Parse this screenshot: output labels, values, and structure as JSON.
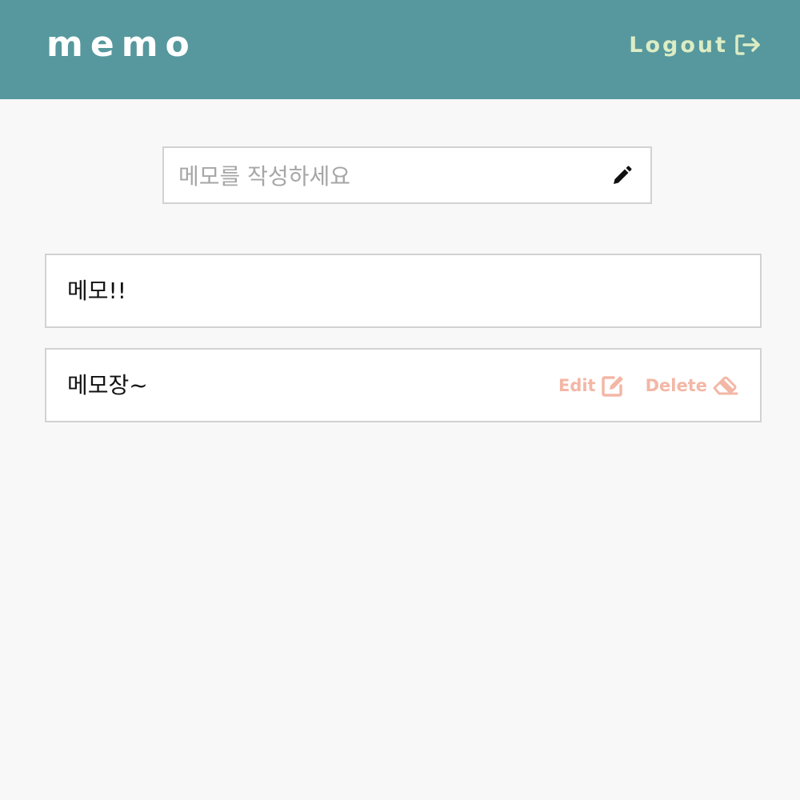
{
  "header": {
    "logo": "memo",
    "logout_label": "Logout",
    "bg_color": "#56989d"
  },
  "compose": {
    "placeholder": "메모를 작성하세요",
    "value": "",
    "icon": "pencil-icon"
  },
  "memos": [
    {
      "text": "메모!!",
      "actions_visible": false
    },
    {
      "text": "메모장~",
      "actions_visible": true,
      "edit_label": "Edit",
      "delete_label": "Delete"
    }
  ],
  "colors": {
    "accent": "#f3b7a6",
    "logout": "#dcecc4",
    "background": "#f8f8f8"
  }
}
